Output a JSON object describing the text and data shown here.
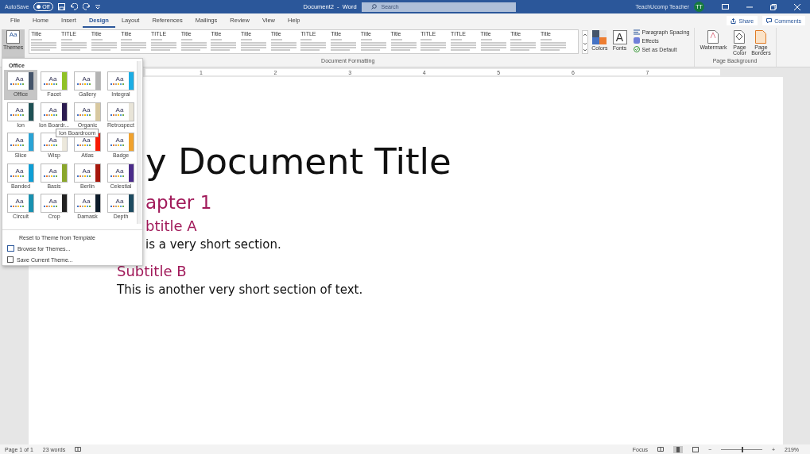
{
  "title_bar": {
    "autosave_label": "AutoSave",
    "autosave_state": "Off",
    "autosave_on": false,
    "title": "Document2  -  Word",
    "search_placeholder": "Search",
    "user_name": "TeachUcomp Teacher",
    "avatar_initials": "TT"
  },
  "tabs": [
    {
      "label": "File",
      "selected": false
    },
    {
      "label": "Home",
      "selected": false
    },
    {
      "label": "Insert",
      "selected": false
    },
    {
      "label": "Design",
      "selected": true
    },
    {
      "label": "Layout",
      "selected": false
    },
    {
      "label": "References",
      "selected": false
    },
    {
      "label": "Mailings",
      "selected": false
    },
    {
      "label": "Review",
      "selected": false
    },
    {
      "label": "View",
      "selected": false
    },
    {
      "label": "Help",
      "selected": false
    }
  ],
  "share_label": "Share",
  "comments_label": "Comments",
  "ribbon": {
    "themes_button": {
      "label": "Themes",
      "sample": "Aa"
    },
    "style_sets": [
      {
        "title": "Title"
      },
      {
        "title": "TITLE"
      },
      {
        "title": "Title"
      },
      {
        "title": "Title"
      },
      {
        "title": "TITLE"
      },
      {
        "title": "Title"
      },
      {
        "title": "Title"
      },
      {
        "title": "Title"
      },
      {
        "title": "Title"
      },
      {
        "title": "TITLE"
      },
      {
        "title": "Title"
      },
      {
        "title": "Title"
      },
      {
        "title": "Title"
      },
      {
        "title": "TITLE"
      },
      {
        "title": "TITLE"
      },
      {
        "title": "Title"
      },
      {
        "title": "Title"
      },
      {
        "title": "Title"
      }
    ],
    "colors_label": "Colors",
    "fonts_label": "Fonts",
    "fonts_letter": "A",
    "paragraph_spacing": "Paragraph Spacing",
    "effects": "Effects",
    "set_as_default": "Set as Default",
    "group_1_label": "Document Formatting",
    "watermark": "Watermark",
    "page_color": "Page Color",
    "page_borders": "Page Borders",
    "group_2_label": "Page Background"
  },
  "ruler": [
    "1",
    "2",
    "3",
    "4",
    "5",
    "6",
    "7"
  ],
  "document": {
    "title": "y Document Title",
    "chapter": "apter 1",
    "subtitle_a": "btitle A",
    "body_a": "is a very short section.",
    "subtitle_b": "Subtitle B",
    "body_b": "This is another very short section of text."
  },
  "themes_menu": {
    "section": "Office",
    "themes": [
      {
        "name": "Office",
        "sample": "Aa",
        "color": "#44546a",
        "selected": true
      },
      {
        "name": "Facet",
        "sample": "Aa",
        "color": "#90c226",
        "selected": false
      },
      {
        "name": "Gallery",
        "sample": "Aa",
        "color": "#b4b4b4",
        "selected": false
      },
      {
        "name": "Integral",
        "sample": "Aa",
        "color": "#1cade4",
        "selected": false
      },
      {
        "name": "Ion",
        "sample": "Aa",
        "color": "#1e5155",
        "selected": false
      },
      {
        "name": "Ion Boardr...",
        "sample": "Aa",
        "color": "#2b1b4f",
        "selected": false
      },
      {
        "name": "Organic",
        "sample": "Aa",
        "color": "#d8c8a0",
        "selected": false
      },
      {
        "name": "Retrospect",
        "sample": "Aa",
        "color": "#e8e4d8",
        "selected": false
      },
      {
        "name": "Slice",
        "sample": "Aa",
        "color": "#2aa3d5",
        "selected": false
      },
      {
        "name": "Wisp",
        "sample": "Aa",
        "color": "#ece8dc",
        "selected": false
      },
      {
        "name": "Atlas",
        "sample": "Aa",
        "color": "#f81b02",
        "selected": false
      },
      {
        "name": "Badge",
        "sample": "Aa",
        "color": "#f0a22e",
        "selected": false
      },
      {
        "name": "Banded",
        "sample": "Aa",
        "color": "#0f9ed5",
        "selected": false
      },
      {
        "name": "Basis",
        "sample": "Aa",
        "color": "#8aa62b",
        "selected": false
      },
      {
        "name": "Berlin",
        "sample": "Aa",
        "color": "#a6170c",
        "selected": false
      },
      {
        "name": "Celestial",
        "sample": "Aa",
        "color": "#4b2c8a",
        "selected": false
      },
      {
        "name": "Circuit",
        "sample": "Aa",
        "color": "#1891b0",
        "selected": false
      },
      {
        "name": "Crop",
        "sample": "Aa",
        "color": "#222222",
        "selected": false
      },
      {
        "name": "Damask",
        "sample": "Aa",
        "color": "#0d1b2a",
        "selected": false
      },
      {
        "name": "Depth",
        "sample": "Aa",
        "color": "#1d4b60",
        "selected": false
      }
    ],
    "tooltip": "Ion Boardroom",
    "commands": [
      "Reset to Theme from Template",
      "Browse for Themes...",
      "Save Current Theme..."
    ]
  },
  "status_bar": {
    "page": "Page 1 of 1",
    "words": "23 words",
    "focus": "Focus",
    "zoom_out": "−",
    "zoom_slider": {
      "level": 0.5
    },
    "zoom_in": "+",
    "zoom": "219%"
  }
}
